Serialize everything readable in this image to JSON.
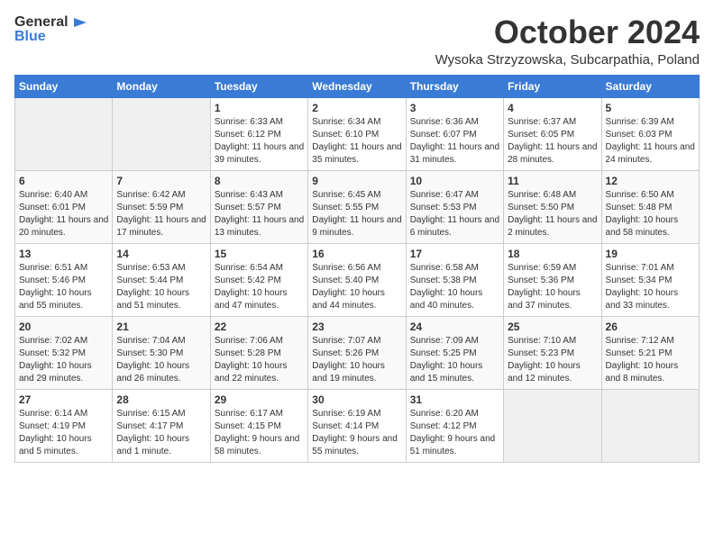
{
  "header": {
    "logo_general": "General",
    "logo_blue": "Blue",
    "month": "October 2024",
    "location": "Wysoka Strzyzowska, Subcarpathia, Poland"
  },
  "weekdays": [
    "Sunday",
    "Monday",
    "Tuesday",
    "Wednesday",
    "Thursday",
    "Friday",
    "Saturday"
  ],
  "weeks": [
    [
      {
        "day": "",
        "info": ""
      },
      {
        "day": "",
        "info": ""
      },
      {
        "day": "1",
        "info": "Sunrise: 6:33 AM\nSunset: 6:12 PM\nDaylight: 11 hours and 39 minutes."
      },
      {
        "day": "2",
        "info": "Sunrise: 6:34 AM\nSunset: 6:10 PM\nDaylight: 11 hours and 35 minutes."
      },
      {
        "day": "3",
        "info": "Sunrise: 6:36 AM\nSunset: 6:07 PM\nDaylight: 11 hours and 31 minutes."
      },
      {
        "day": "4",
        "info": "Sunrise: 6:37 AM\nSunset: 6:05 PM\nDaylight: 11 hours and 28 minutes."
      },
      {
        "day": "5",
        "info": "Sunrise: 6:39 AM\nSunset: 6:03 PM\nDaylight: 11 hours and 24 minutes."
      }
    ],
    [
      {
        "day": "6",
        "info": "Sunrise: 6:40 AM\nSunset: 6:01 PM\nDaylight: 11 hours and 20 minutes."
      },
      {
        "day": "7",
        "info": "Sunrise: 6:42 AM\nSunset: 5:59 PM\nDaylight: 11 hours and 17 minutes."
      },
      {
        "day": "8",
        "info": "Sunrise: 6:43 AM\nSunset: 5:57 PM\nDaylight: 11 hours and 13 minutes."
      },
      {
        "day": "9",
        "info": "Sunrise: 6:45 AM\nSunset: 5:55 PM\nDaylight: 11 hours and 9 minutes."
      },
      {
        "day": "10",
        "info": "Sunrise: 6:47 AM\nSunset: 5:53 PM\nDaylight: 11 hours and 6 minutes."
      },
      {
        "day": "11",
        "info": "Sunrise: 6:48 AM\nSunset: 5:50 PM\nDaylight: 11 hours and 2 minutes."
      },
      {
        "day": "12",
        "info": "Sunrise: 6:50 AM\nSunset: 5:48 PM\nDaylight: 10 hours and 58 minutes."
      }
    ],
    [
      {
        "day": "13",
        "info": "Sunrise: 6:51 AM\nSunset: 5:46 PM\nDaylight: 10 hours and 55 minutes."
      },
      {
        "day": "14",
        "info": "Sunrise: 6:53 AM\nSunset: 5:44 PM\nDaylight: 10 hours and 51 minutes."
      },
      {
        "day": "15",
        "info": "Sunrise: 6:54 AM\nSunset: 5:42 PM\nDaylight: 10 hours and 47 minutes."
      },
      {
        "day": "16",
        "info": "Sunrise: 6:56 AM\nSunset: 5:40 PM\nDaylight: 10 hours and 44 minutes."
      },
      {
        "day": "17",
        "info": "Sunrise: 6:58 AM\nSunset: 5:38 PM\nDaylight: 10 hours and 40 minutes."
      },
      {
        "day": "18",
        "info": "Sunrise: 6:59 AM\nSunset: 5:36 PM\nDaylight: 10 hours and 37 minutes."
      },
      {
        "day": "19",
        "info": "Sunrise: 7:01 AM\nSunset: 5:34 PM\nDaylight: 10 hours and 33 minutes."
      }
    ],
    [
      {
        "day": "20",
        "info": "Sunrise: 7:02 AM\nSunset: 5:32 PM\nDaylight: 10 hours and 29 minutes."
      },
      {
        "day": "21",
        "info": "Sunrise: 7:04 AM\nSunset: 5:30 PM\nDaylight: 10 hours and 26 minutes."
      },
      {
        "day": "22",
        "info": "Sunrise: 7:06 AM\nSunset: 5:28 PM\nDaylight: 10 hours and 22 minutes."
      },
      {
        "day": "23",
        "info": "Sunrise: 7:07 AM\nSunset: 5:26 PM\nDaylight: 10 hours and 19 minutes."
      },
      {
        "day": "24",
        "info": "Sunrise: 7:09 AM\nSunset: 5:25 PM\nDaylight: 10 hours and 15 minutes."
      },
      {
        "day": "25",
        "info": "Sunrise: 7:10 AM\nSunset: 5:23 PM\nDaylight: 10 hours and 12 minutes."
      },
      {
        "day": "26",
        "info": "Sunrise: 7:12 AM\nSunset: 5:21 PM\nDaylight: 10 hours and 8 minutes."
      }
    ],
    [
      {
        "day": "27",
        "info": "Sunrise: 6:14 AM\nSunset: 4:19 PM\nDaylight: 10 hours and 5 minutes."
      },
      {
        "day": "28",
        "info": "Sunrise: 6:15 AM\nSunset: 4:17 PM\nDaylight: 10 hours and 1 minute."
      },
      {
        "day": "29",
        "info": "Sunrise: 6:17 AM\nSunset: 4:15 PM\nDaylight: 9 hours and 58 minutes."
      },
      {
        "day": "30",
        "info": "Sunrise: 6:19 AM\nSunset: 4:14 PM\nDaylight: 9 hours and 55 minutes."
      },
      {
        "day": "31",
        "info": "Sunrise: 6:20 AM\nSunset: 4:12 PM\nDaylight: 9 hours and 51 minutes."
      },
      {
        "day": "",
        "info": ""
      },
      {
        "day": "",
        "info": ""
      }
    ]
  ]
}
